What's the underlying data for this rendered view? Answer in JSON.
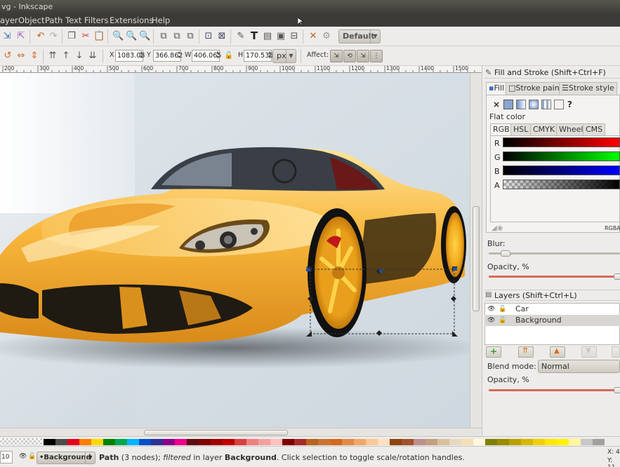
{
  "window": {
    "title": "vg - Inkscape"
  },
  "menu": [
    "ayer",
    "Object",
    "Path",
    "Text",
    "Filters",
    "Extensions",
    "Help"
  ],
  "commands": {
    "style_dropdown": "Default"
  },
  "controls": {
    "x_label": "X",
    "x_value": "1083.08",
    "y_label": "Y",
    "y_value": "366.862",
    "w_label": "W",
    "w_value": "406.065",
    "h_label": "H",
    "h_value": "170.536",
    "unit": "px",
    "affect_label": "Affect:"
  },
  "ruler": {
    "labels": [
      "200",
      "300",
      "400",
      "500",
      "600",
      "700",
      "800",
      "900",
      "1000",
      "1100",
      "1200",
      "1300",
      "1400",
      "1500"
    ]
  },
  "fill_stroke": {
    "title": "Fill and Stroke (Shift+Ctrl+F)",
    "tabs": [
      "Fill",
      "Stroke paint",
      "Stroke style"
    ],
    "flat_color_label": "Flat color",
    "mode_tabs": [
      "RGB",
      "HSL",
      "CMYK",
      "Wheel",
      "CMS"
    ],
    "channels": [
      "R",
      "G",
      "B",
      "A"
    ],
    "rgba_label": "RGBA",
    "blur_label": "Blur:",
    "opacity_label": "Opacity, %",
    "unset_glyph": "×",
    "unknown_glyph": "?"
  },
  "layers": {
    "title": "Layers (Shift+Ctrl+L)",
    "items": [
      {
        "name": "Car",
        "selected": false
      },
      {
        "name": "Background",
        "selected": true
      }
    ],
    "blend_mode_label": "Blend mode:",
    "blend_mode_value": "Normal",
    "opacity_label": "Opacity, %"
  },
  "status": {
    "zoom": "10",
    "layer": "•Background",
    "message_bold1": "Path",
    "message_part1": " (3 nodes); ",
    "message_italic": "filtered",
    "message_part2": " in layer ",
    "message_bold2": "Background",
    "message_part3": ". Click selection to toggle scale/rotation handles.",
    "coord_x": "X:  4",
    "coord_y": "Y: 11"
  },
  "palette_colors": [
    "#000000",
    "#4d4d4d",
    "#e6001e",
    "#ff7f00",
    "#ffd700",
    "#008000",
    "#00a651",
    "#00b4ff",
    "#0050c8",
    "#2e3192",
    "#8b008b",
    "#ec008c",
    "#5e0b15",
    "#800000",
    "#a00000",
    "#c00000",
    "#d84040",
    "#f08080",
    "#f4a0a0",
    "#ffc0c0",
    "#7f0000",
    "#a52a2a",
    "#b5651d",
    "#c87533",
    "#d2691e",
    "#e08a48",
    "#f0a868",
    "#f8c898",
    "#ffe0c0",
    "#8b4513",
    "#a0522d",
    "#bc8f8f",
    "#c0a080",
    "#d8c0a0",
    "#e8d8c0",
    "#f5deb3",
    "#fff8dc",
    "#808000",
    "#9a8c00",
    "#b8a000",
    "#d4b800",
    "#f0d000",
    "#ffe600",
    "#fff200",
    "#fff799",
    "#c8c8c8",
    "#a0a0a0"
  ]
}
